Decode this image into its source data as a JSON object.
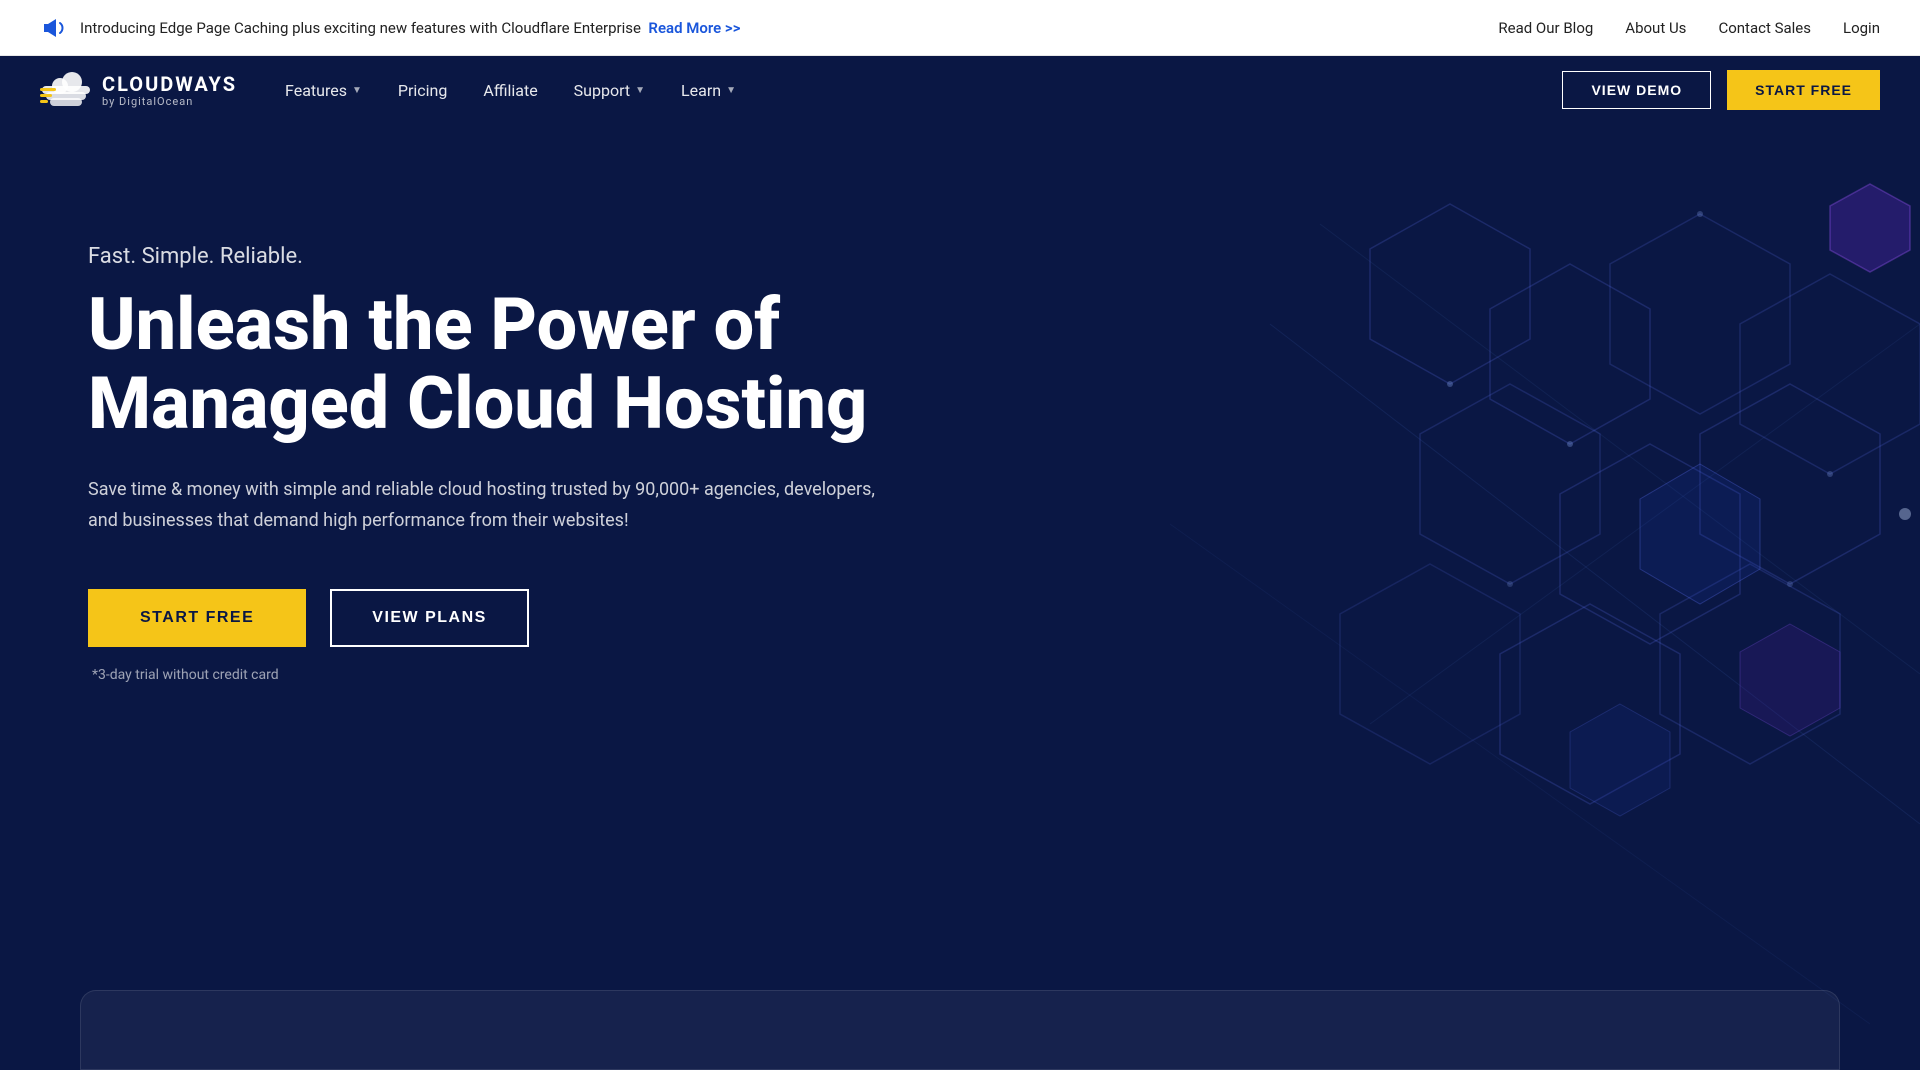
{
  "topbar": {
    "announcement": "Introducing Edge Page Caching plus exciting new features with Cloudflare Enterprise",
    "read_more_label": "Read More >>",
    "links": [
      {
        "label": "Read Our Blog",
        "name": "read-our-blog-link"
      },
      {
        "label": "About Us",
        "name": "about-us-link"
      },
      {
        "label": "Contact Sales",
        "name": "contact-sales-link"
      },
      {
        "label": "Login",
        "name": "login-link"
      }
    ]
  },
  "nav": {
    "logo_brand": "CLOUDWAYS",
    "logo_sub": "by DigitalOcean",
    "links": [
      {
        "label": "Features",
        "has_dropdown": true,
        "name": "features-link"
      },
      {
        "label": "Pricing",
        "has_dropdown": false,
        "name": "pricing-link"
      },
      {
        "label": "Affiliate",
        "has_dropdown": false,
        "name": "affiliate-link"
      },
      {
        "label": "Support",
        "has_dropdown": true,
        "name": "support-link"
      },
      {
        "label": "Learn",
        "has_dropdown": true,
        "name": "learn-link"
      }
    ],
    "view_demo_label": "VIEW DEMO",
    "start_free_label": "START FREE"
  },
  "hero": {
    "tagline": "Fast. Simple. Reliable.",
    "title_line1": "Unleash the Power of",
    "title_line2": "Managed Cloud Hosting",
    "description": "Save time & money with simple and reliable cloud hosting trusted by 90,000+ agencies, developers, and businesses that demand high performance from their websites!",
    "start_free_label": "START FREE",
    "view_plans_label": "VIEW PLANS",
    "trial_note": "*3-day trial without credit card"
  },
  "colors": {
    "brand_dark": "#0a1744",
    "accent_yellow": "#f5c518",
    "text_white": "#ffffff",
    "link_blue": "#1a56db"
  }
}
